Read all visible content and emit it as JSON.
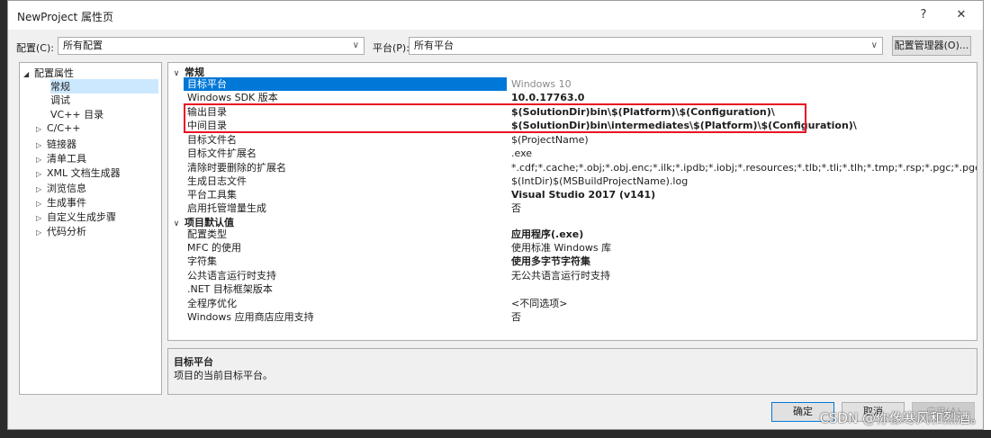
{
  "window": {
    "title": "NewProject 属性页",
    "help": "?",
    "close": "✕"
  },
  "toolbar": {
    "config_label": "配置(C):",
    "config_value": "所有配置",
    "platform_label": "平台(P):",
    "platform_value": "所有平台",
    "config_manager": "配置管理器(O)..."
  },
  "tree": [
    {
      "label": "配置属性",
      "arrow": "◢"
    },
    {
      "label": "常规",
      "arrow": ""
    },
    {
      "label": "调试",
      "arrow": ""
    },
    {
      "label": "VC++ 目录",
      "arrow": ""
    },
    {
      "label": "C/C++",
      "arrow": "▷"
    },
    {
      "label": "链接器",
      "arrow": "▷"
    },
    {
      "label": "清单工具",
      "arrow": "▷"
    },
    {
      "label": "XML 文档生成器",
      "arrow": "▷"
    },
    {
      "label": "浏览信息",
      "arrow": "▷"
    },
    {
      "label": "生成事件",
      "arrow": "▷"
    },
    {
      "label": "自定义生成步骤",
      "arrow": "▷"
    },
    {
      "label": "代码分析",
      "arrow": "▷"
    }
  ],
  "grid": {
    "cat1": {
      "arrow": "∨",
      "label": "常规"
    },
    "cat1_rows": [
      {
        "name": "目标平台",
        "value": "Windows 10"
      },
      {
        "name": "Windows SDK 版本",
        "value": "10.0.17763.0"
      },
      {
        "name": "输出目录",
        "value": "$(SolutionDir)bin\\$(Platform)\\$(Configuration)\\"
      },
      {
        "name": "中间目录",
        "value": "$(SolutionDir)bin\\intermediates\\$(Platform)\\$(Configuration)\\"
      },
      {
        "name": "目标文件名",
        "value": "$(ProjectName)"
      },
      {
        "name": "目标文件扩展名",
        "value": ".exe"
      },
      {
        "name": "清除时要删除的扩展名",
        "value": "*.cdf;*.cache;*.obj;*.obj.enc;*.ilk;*.ipdb;*.iobj;*.resources;*.tlb;*.tli;*.tlh;*.tmp;*.rsp;*.pgc;*.pgd;*.meta;*.tlog;*.manifes"
      },
      {
        "name": "生成日志文件",
        "value": "$(IntDir)$(MSBuildProjectName).log"
      },
      {
        "name": "平台工具集",
        "value": "Visual Studio 2017 (v141)"
      },
      {
        "name": "启用托管增量生成",
        "value": "否"
      }
    ],
    "cat2": {
      "arrow": "∨",
      "label": "项目默认值"
    },
    "cat2_rows": [
      {
        "name": "配置类型",
        "value": "应用程序(.exe)"
      },
      {
        "name": "MFC 的使用",
        "value": "使用标准 Windows 库"
      },
      {
        "name": "字符集",
        "value": "使用多字节字符集"
      },
      {
        "name": "公共语言运行时支持",
        "value": "无公共语言运行时支持"
      },
      {
        "name": ".NET 目标框架版本",
        "value": ""
      },
      {
        "name": "全程序优化",
        "value": "<不同选项>"
      },
      {
        "name": "Windows 应用商店应用支持",
        "value": "否"
      }
    ]
  },
  "description": {
    "title": "目标平台",
    "text": "项目的当前目标平台。"
  },
  "buttons": {
    "ok": "确定",
    "cancel": "取消",
    "apply": "应用(A)"
  },
  "watermark": "CSDN @你像寒风和烈酒。"
}
